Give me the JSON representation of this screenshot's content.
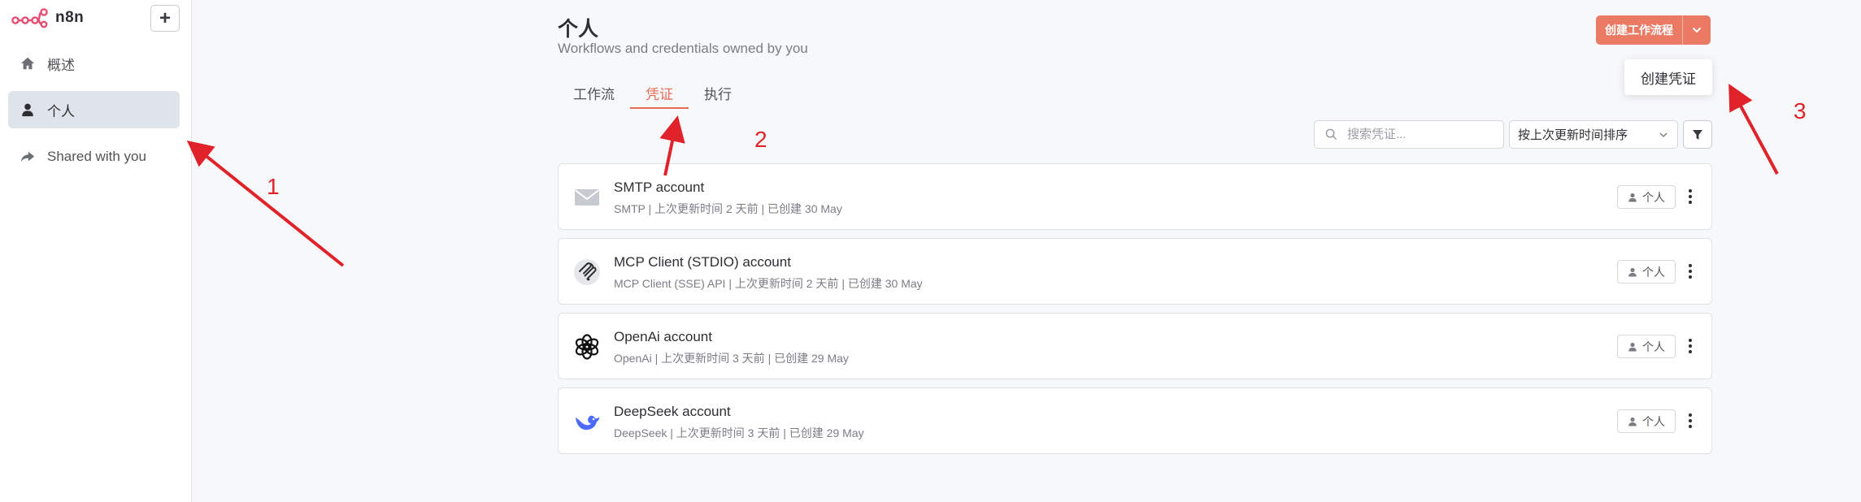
{
  "app": {
    "name": "n8n"
  },
  "sidebar": {
    "items": [
      {
        "label": "概述",
        "icon": "home-icon",
        "active": false
      },
      {
        "label": "个人",
        "icon": "user-icon",
        "active": true
      },
      {
        "label": "Shared with you",
        "icon": "share-icon",
        "active": false
      }
    ]
  },
  "header": {
    "title": "个人",
    "subtitle": "Workflows and credentials owned by you",
    "create_button": "创建工作流程",
    "dropdown_item": "创建凭证"
  },
  "tabs": [
    {
      "label": "工作流",
      "active": false
    },
    {
      "label": "凭证",
      "active": true
    },
    {
      "label": "执行",
      "active": false
    }
  ],
  "toolbar": {
    "search_placeholder": "搜索凭证...",
    "sort_value": "按上次更新时间排序"
  },
  "credentials": [
    {
      "name": "SMTP account",
      "meta": "SMTP | 上次更新时间 2 天前 | 已创建 30 May",
      "badge": "个人",
      "icon": "mail-icon"
    },
    {
      "name": "MCP Client (STDIO) account",
      "meta": "MCP Client (SSE) API | 上次更新时间 2 天前 | 已创建 30 May",
      "badge": "个人",
      "icon": "mcp-icon"
    },
    {
      "name": "OpenAi account",
      "meta": "OpenAi | 上次更新时间 3 天前 | 已创建 29 May",
      "badge": "个人",
      "icon": "openai-icon"
    },
    {
      "name": "DeepSeek account",
      "meta": "DeepSeek | 上次更新时间 3 天前 | 已创建 29 May",
      "badge": "个人",
      "icon": "deepseek-icon"
    }
  ],
  "annotations": [
    {
      "label": "1"
    },
    {
      "label": "2"
    },
    {
      "label": "3"
    }
  ],
  "colors": {
    "accent": "#ea7a64",
    "annotation": "#e0232a",
    "sidebar_active": "#dfe3ea"
  }
}
